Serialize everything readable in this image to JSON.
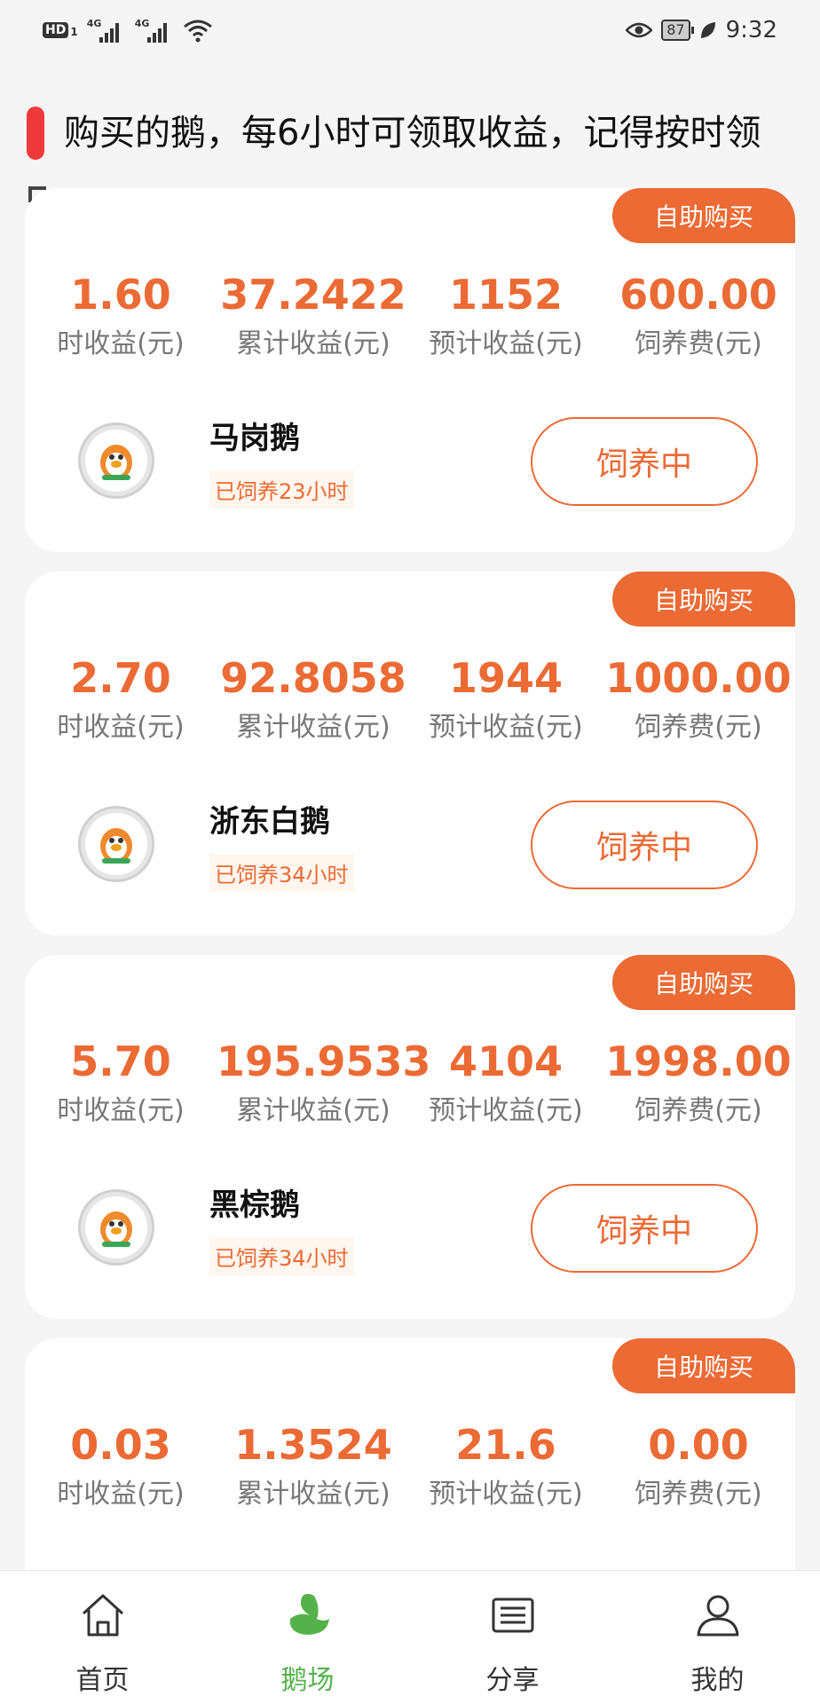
{
  "status_bar": {
    "hd": "HD",
    "hd_sub": "1",
    "signal1": "4G",
    "signal2": "4G",
    "battery": "87",
    "time": "9:32"
  },
  "notice": {
    "text": "购买的鹅，每6小时可领取收益，记得按时领"
  },
  "cards": [
    {
      "tag": "自助购买",
      "stats": [
        {
          "value": "1.60",
          "label": "时收益(元)"
        },
        {
          "value": "37.2422",
          "label": "累计收益(元)"
        },
        {
          "value": "1152",
          "label": "预计收益(元)"
        },
        {
          "value": "600.00",
          "label": "饲养费(元)"
        }
      ],
      "name": "马岗鹅",
      "fed_time": "已饲养23小时",
      "button": "饲养中"
    },
    {
      "tag": "自助购买",
      "stats": [
        {
          "value": "2.70",
          "label": "时收益(元)"
        },
        {
          "value": "92.8058",
          "label": "累计收益(元)"
        },
        {
          "value": "1944",
          "label": "预计收益(元)"
        },
        {
          "value": "1000.00",
          "label": "饲养费(元)"
        }
      ],
      "name": "浙东白鹅",
      "fed_time": "已饲养34小时",
      "button": "饲养中"
    },
    {
      "tag": "自助购买",
      "stats": [
        {
          "value": "5.70",
          "label": "时收益(元)"
        },
        {
          "value": "195.9533",
          "label": "累计收益(元)"
        },
        {
          "value": "4104",
          "label": "预计收益(元)"
        },
        {
          "value": "1998.00",
          "label": "饲养费(元)"
        }
      ],
      "name": "黑棕鹅",
      "fed_time": "已饲养34小时",
      "button": "饲养中"
    },
    {
      "tag": "自助购买",
      "stats": [
        {
          "value": "0.03",
          "label": "时收益(元)"
        },
        {
          "value": "1.3524",
          "label": "累计收益(元)"
        },
        {
          "value": "21.6",
          "label": "预计收益(元)"
        },
        {
          "value": "0.00",
          "label": "饲养费(元)"
        }
      ]
    }
  ],
  "tabbar": [
    {
      "label": "首页",
      "icon": "home-icon"
    },
    {
      "label": "鹅场",
      "icon": "goose-icon",
      "active": true
    },
    {
      "label": "分享",
      "icon": "share-ticket-icon"
    },
    {
      "label": "我的",
      "icon": "user-icon"
    }
  ],
  "colors": {
    "accent": "#ec6a34",
    "notice_bar": "#f0393b",
    "tab_active": "#55b24b"
  }
}
